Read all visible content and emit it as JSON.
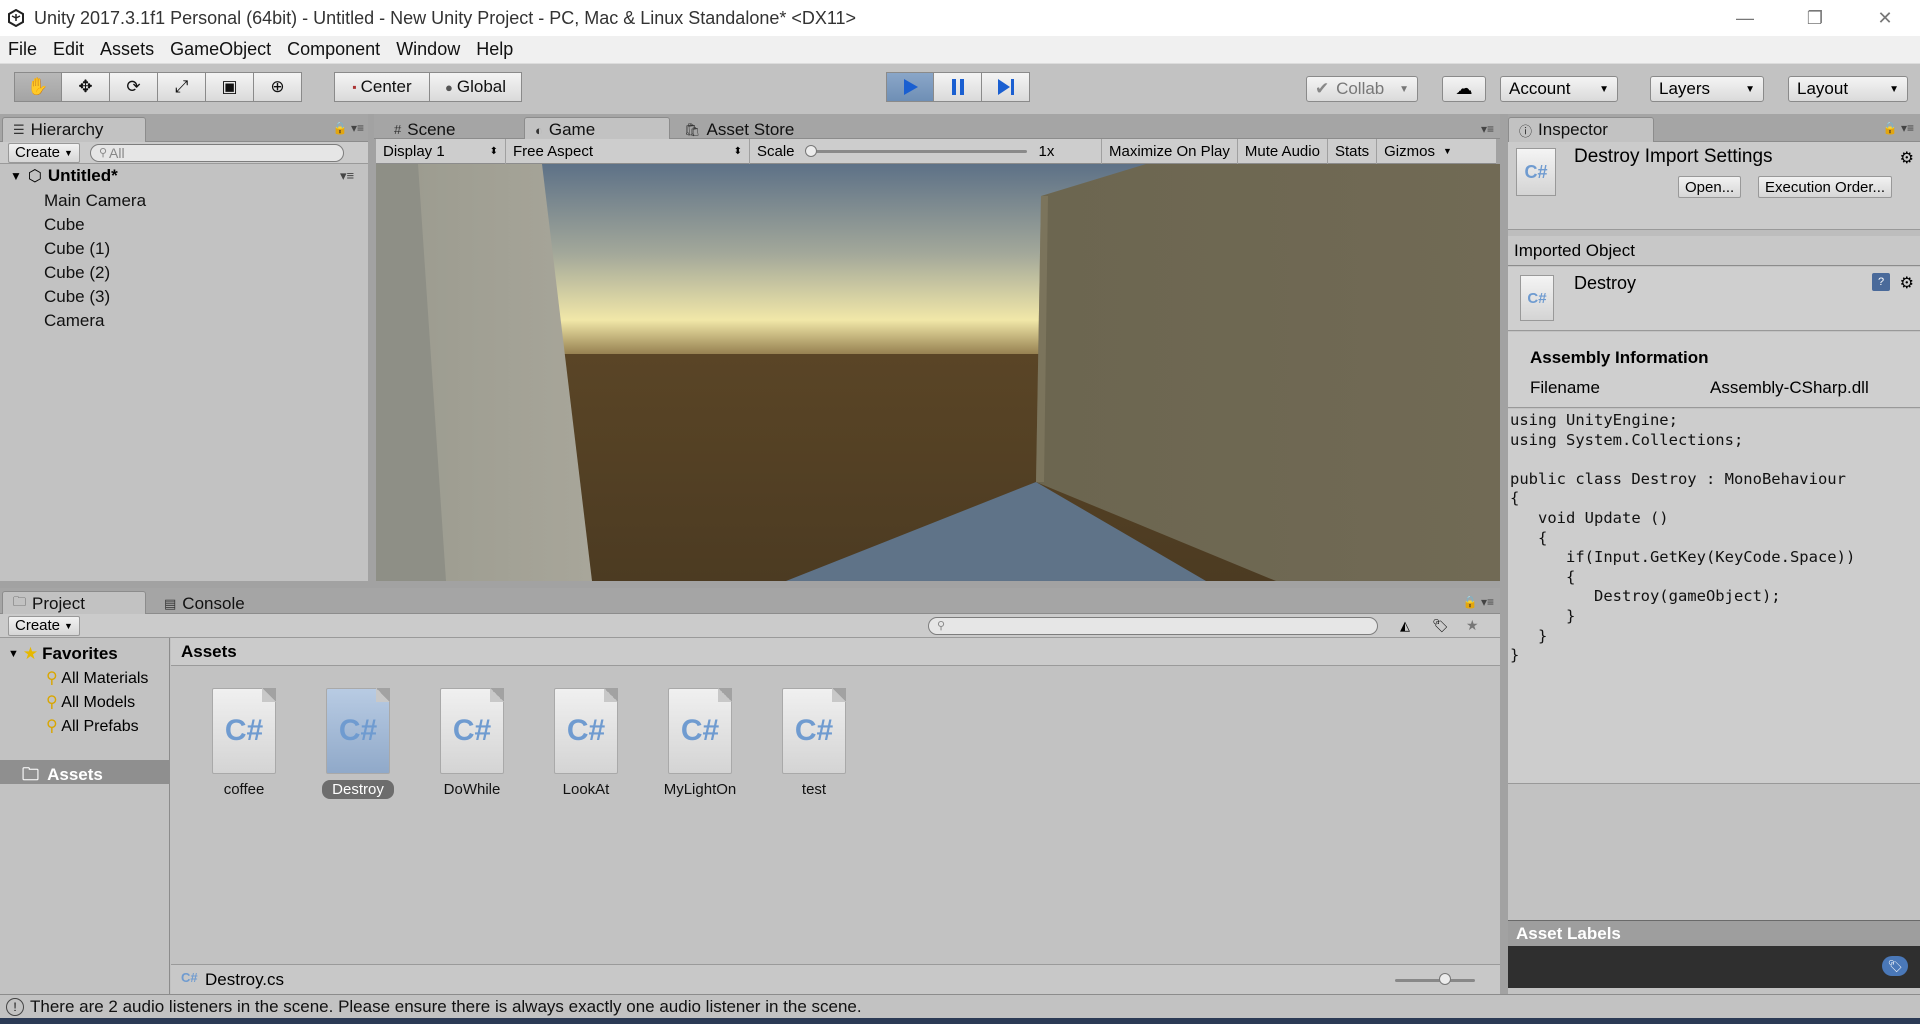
{
  "window": {
    "title": "Unity 2017.3.1f1 Personal (64bit) - Untitled - New Unity Project - PC, Mac & Linux Standalone* <DX11>",
    "minimize": "—",
    "restore": "❐",
    "close": "✕"
  },
  "menu": [
    "File",
    "Edit",
    "Assets",
    "GameObject",
    "Component",
    "Window",
    "Help"
  ],
  "toolbar": {
    "pivot": "Center",
    "space": "Global",
    "collab": "Collab",
    "account": "Account",
    "layers": "Layers",
    "layout": "Layout"
  },
  "hierarchy": {
    "tab": "Hierarchy",
    "create": "Create",
    "search_placeholder": "All",
    "scene": "Untitled*",
    "items": [
      "Main Camera",
      "Cube",
      "Cube (1)",
      "Cube (2)",
      "Cube (3)",
      "Camera"
    ]
  },
  "center_tabs": {
    "scene": "Scene",
    "game": "Game",
    "asset_store": "Asset Store"
  },
  "game_bar": {
    "display": "Display 1",
    "aspect": "Free Aspect",
    "scale_label": "Scale",
    "scale_value": "1x",
    "maximize": "Maximize On Play",
    "mute": "Mute Audio",
    "stats": "Stats",
    "gizmos": "Gizmos"
  },
  "inspector": {
    "tab": "Inspector",
    "header_title": "Destroy Import Settings",
    "open_button": "Open...",
    "execution_order_button": "Execution Order...",
    "imported_object": "Imported Object",
    "object_name": "Destroy",
    "assembly_heading": "Assembly Information",
    "filename_label": "Filename",
    "filename_value": "Assembly-CSharp.dll",
    "code": "using UnityEngine;\nusing System.Collections;\n\npublic class Destroy : MonoBehaviour\n{\n   void Update ()\n   {\n      if(Input.GetKey(KeyCode.Space))\n      {\n         Destroy(gameObject);\n      }\n   }\n}",
    "asset_labels": "Asset Labels"
  },
  "project": {
    "tab": "Project",
    "console_tab": "Console",
    "create": "Create",
    "favorites": "Favorites",
    "favorite_items": [
      "All Materials",
      "All Models",
      "All Prefabs"
    ],
    "assets_root": "Assets",
    "breadcrumb": "Assets",
    "assets": [
      "coffee",
      "Destroy",
      "DoWhile",
      "LookAt",
      "MyLightOn",
      "test"
    ],
    "selected_asset": "Destroy",
    "selected_path": "Destroy.cs"
  },
  "status": {
    "message": "There are 2 audio listeners in the scene. Please ensure there is always exactly one audio listener in the scene."
  },
  "colors": {
    "panel_bg": "#c2c2c2",
    "tab_strip": "#a5a5a5",
    "play_active": "#6f8fb5",
    "cs_icon": "#6f9bd0"
  }
}
